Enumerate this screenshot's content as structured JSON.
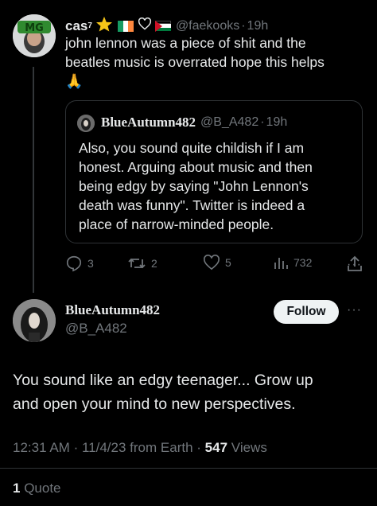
{
  "tweet1": {
    "display_name": "cas",
    "superscript": "7",
    "handle": "@faekooks",
    "sep": "·",
    "time": "19h",
    "text_line1": "john lennon was a piece of shit and the",
    "text_line2": "beatles music is overrated hope this helps",
    "emoji": "🙏",
    "avatar_text": "MG",
    "quote": {
      "author_name": "BlueAutumn482",
      "handle": "@B_A482",
      "sep": "·",
      "time": "19h",
      "lines": [
        "Also, you sound quite childish if I am",
        "honest. Arguing about music and then",
        "being edgy by saying \"John Lennon's",
        "death was funny\". Twitter is indeed a",
        "place of narrow-minded people."
      ]
    },
    "actions": {
      "replies": "3",
      "retweets": "2",
      "likes": "5",
      "views": "732"
    }
  },
  "tweet2": {
    "display_name": "BlueAutumn482",
    "handle": "@B_A482",
    "follow_label": "Follow",
    "text_line1": "You sound like an edgy teenager... Grow up",
    "text_line2": "and open your mind to new perspectives.",
    "meta": {
      "time": "12:31 AM",
      "sep1": "·",
      "date": "11/4/23",
      "source": "from Earth",
      "sep2": "·",
      "views_count": "547",
      "views_label": "Views"
    },
    "quotes": {
      "count": "1",
      "label": "Quote"
    }
  },
  "colors": {
    "background": "#000000",
    "text": "#e7e9ea",
    "muted": "#71767b",
    "border": "#2f3336",
    "follow_bg": "#eff3f4",
    "star": "#f5c518",
    "ireland_green": "#169b62",
    "ireland_orange": "#ff883e",
    "palestine_red": "#ce1126",
    "palestine_green": "#007a3d"
  }
}
